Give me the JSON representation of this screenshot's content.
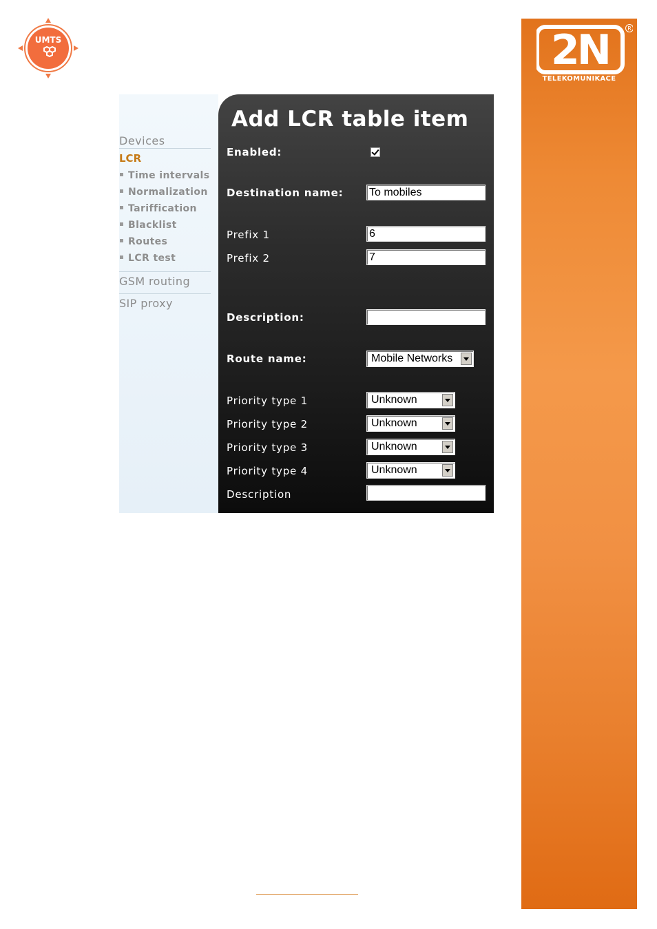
{
  "badge": {
    "text": "UMTS"
  },
  "brand": {
    "logo_text": "2N",
    "subtitle": "TELEKOMUNIKACE",
    "registered": "®"
  },
  "nav": {
    "top_item": "Devices",
    "active_item": "LCR",
    "sub_items": [
      "Time intervals",
      "Normalization",
      "Tariffication",
      "Blacklist",
      "Routes",
      "LCR test"
    ],
    "bottom_items": [
      "GSM routing",
      "SIP proxy"
    ]
  },
  "form": {
    "title": "Add LCR table item",
    "enabled_label": "Enabled:",
    "enabled_checked": true,
    "destination_label": "Destination name:",
    "destination_value": "To mobiles",
    "prefix1_label": "Prefix 1",
    "prefix1_value": "6",
    "prefix2_label": "Prefix 2",
    "prefix2_value": "7",
    "description_label": "Description:",
    "description_value": "",
    "route_label": "Route name:",
    "route_value": "Mobile Networks",
    "priority_labels": [
      "Priority type 1",
      "Priority type 2",
      "Priority type 3",
      "Priority type 4"
    ],
    "priority_values": [
      "Unknown",
      "Unknown",
      "Unknown",
      "Unknown"
    ],
    "description2_label": "Description",
    "description2_value": ""
  },
  "colors": {
    "brand_orange": "#ee8a35",
    "nav_active": "#c67a17",
    "form_bg": "#2d2d2d"
  }
}
